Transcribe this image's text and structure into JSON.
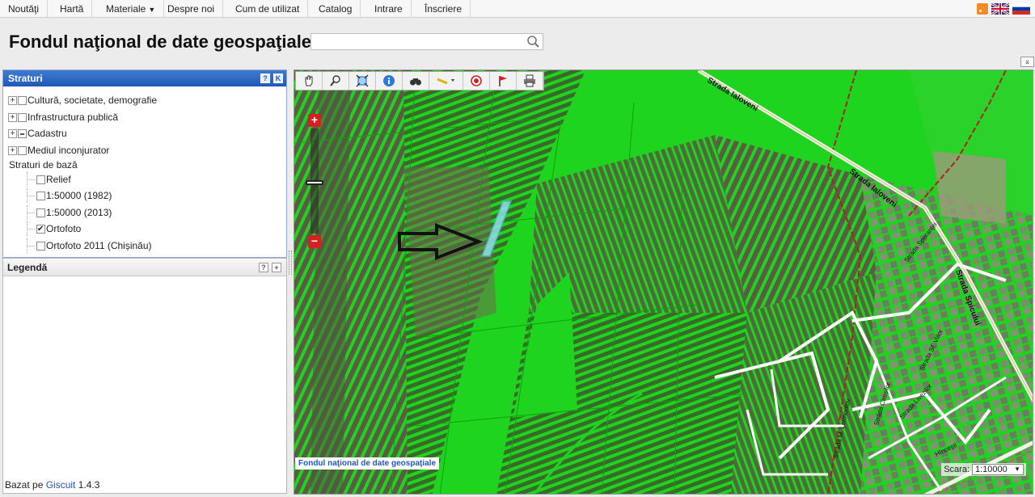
{
  "nav": {
    "items": [
      "Noutăţi",
      "Hartă",
      "Materiale",
      "Despre noi",
      "Cum de utilizat",
      "Catalog",
      "Intrare",
      "Înscriere"
    ]
  },
  "header": {
    "title": "Fondul naţional de date geospaţiale",
    "search_placeholder": ""
  },
  "layers": {
    "title": "Straturi",
    "help": "?",
    "collapse": "K",
    "groups": [
      {
        "label": "Cultură, societate, demografie",
        "state": "unchecked"
      },
      {
        "label": "Infrastructura publică",
        "state": "unchecked"
      },
      {
        "label": "Cadastru",
        "state": "partial"
      },
      {
        "label": "Mediul inconjurator",
        "state": "unchecked"
      }
    ],
    "base_title": "Straturi de bază",
    "base_layers": [
      {
        "label": "Relief",
        "state": "unchecked"
      },
      {
        "label": "1:50000 (1982)",
        "state": "unchecked"
      },
      {
        "label": "1:50000 (2013)",
        "state": "unchecked"
      },
      {
        "label": "Ortofoto",
        "state": "checked"
      },
      {
        "label": "Ortofoto 2011 (Chișinău)",
        "state": "unchecked"
      }
    ]
  },
  "legend": {
    "title": "Legendă",
    "help": "?",
    "expand": "+"
  },
  "footer": {
    "prefix": "Bazat pe",
    "link": "Giscuit",
    "version": "1.4.3"
  },
  "map": {
    "attribution": "Fondul naţional de date geospaţiale",
    "scale_label": "Scara:",
    "scale_value": "1:10000",
    "zoom_in": "+",
    "zoom_out": "−",
    "streets": {
      "ialoveni_1": "Strada Ialoveni",
      "ialoveni_2": "Strada Ialoveni",
      "spicului": "Strada Spicului",
      "sperantei": "Strada Speranţei",
      "viilor": "Strada Sf. Viilor",
      "ceresnelor": "Strada Cireşilor",
      "livezilor": "Strada Livezilor",
      "lermontov": "Strada M. Lermontov",
      "hincesti": "Hînceşti"
    },
    "tools": [
      "pan-icon",
      "zoom-box-icon",
      "full-extent-icon",
      "info-icon",
      "find-icon",
      "measure-icon",
      "draw-point-icon",
      "flag-icon",
      "print-icon"
    ]
  },
  "colors": {
    "accent": "#2058b8",
    "parcel": "#1ed41e",
    "boundary": "#b02020"
  }
}
